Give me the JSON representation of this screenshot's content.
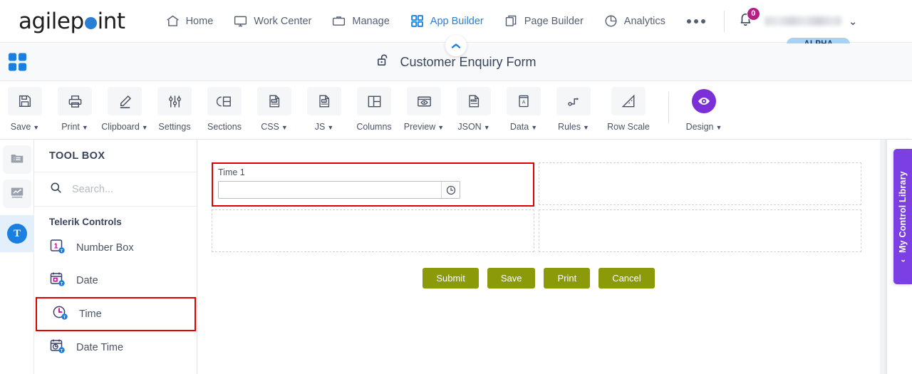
{
  "topnav": {
    "logo_before": "agilep",
    "logo_after": "int",
    "items": [
      {
        "label": "Home",
        "icon": "home-icon",
        "active": false
      },
      {
        "label": "Work Center",
        "icon": "monitor-icon",
        "active": false
      },
      {
        "label": "Manage",
        "icon": "briefcase-icon",
        "active": false
      },
      {
        "label": "App Builder",
        "icon": "grid-icon",
        "active": true
      },
      {
        "label": "Page Builder",
        "icon": "copy-icon",
        "active": false
      },
      {
        "label": "Analytics",
        "icon": "pie-chart-icon",
        "active": false
      }
    ],
    "more_label": "more-icon",
    "notification_count": "0",
    "user_name": "",
    "alpha_badge": "ALPHA",
    "accent_blue": "#2a7fd4",
    "badge_color": "#b51f87",
    "alpha_bg": "#a9d2f2"
  },
  "titlebar": {
    "title": "Customer Enquiry Form",
    "lock_icon": "unlock-icon",
    "grid_icon": "apps-grid-icon",
    "collapse_icon": "chevron-up-icon"
  },
  "toolbar": {
    "tools": [
      {
        "label": "Save",
        "icon": "save-disk-icon",
        "caret": true
      },
      {
        "label": "Print",
        "icon": "printer-icon",
        "caret": true
      },
      {
        "label": "Clipboard",
        "icon": "pencil-icon",
        "caret": true
      },
      {
        "label": "Settings",
        "icon": "sliders-icon",
        "caret": false
      },
      {
        "label": "Sections",
        "icon": "sections-icon",
        "caret": false
      },
      {
        "label": "CSS",
        "icon": "css-file-icon",
        "caret": true
      },
      {
        "label": "JS",
        "icon": "js-file-icon",
        "caret": true
      },
      {
        "label": "Columns",
        "icon": "columns-icon",
        "caret": false
      },
      {
        "label": "Preview",
        "icon": "eye-window-icon",
        "caret": true
      },
      {
        "label": "JSON",
        "icon": "json-file-icon",
        "caret": true
      },
      {
        "label": "Data",
        "icon": "data-book-icon",
        "caret": true
      },
      {
        "label": "Rules",
        "icon": "rules-flow-icon",
        "caret": true
      },
      {
        "label": "Row Scale",
        "icon": "ruler-icon",
        "caret": false
      }
    ],
    "design": {
      "label": "Design",
      "icon": "eye-icon",
      "caret": true,
      "color": "#7b2fd6"
    }
  },
  "rail": {
    "items": [
      {
        "name": "folder-list-icon",
        "selected": false
      },
      {
        "name": "analytics-chart-icon",
        "selected": false
      },
      {
        "name": "telerik-t-icon",
        "label": "T",
        "selected": true
      }
    ]
  },
  "toolbox": {
    "header": "TOOL BOX",
    "search_placeholder": "Search...",
    "search_value": "",
    "group_label": "Telerik Controls",
    "items": [
      {
        "label": "Number Box",
        "icon": "number-box-icon",
        "selected": false
      },
      {
        "label": "Date",
        "icon": "date-icon",
        "selected": false
      },
      {
        "label": "Time",
        "icon": "time-clock-icon",
        "selected": true
      },
      {
        "label": "Date Time",
        "icon": "date-time-icon",
        "selected": false
      }
    ]
  },
  "canvas": {
    "field": {
      "label": "Time 1",
      "value": "",
      "picker_icon": "clock-icon",
      "selected": true,
      "highlight_color": "#e00000"
    },
    "buttons": [
      {
        "label": "Submit"
      },
      {
        "label": "Save"
      },
      {
        "label": "Print"
      },
      {
        "label": "Cancel"
      }
    ],
    "button_color": "#8a9a09"
  },
  "right_panel": {
    "label": "My Control Library",
    "chevron": "‹",
    "color": "#7b3fe4"
  }
}
